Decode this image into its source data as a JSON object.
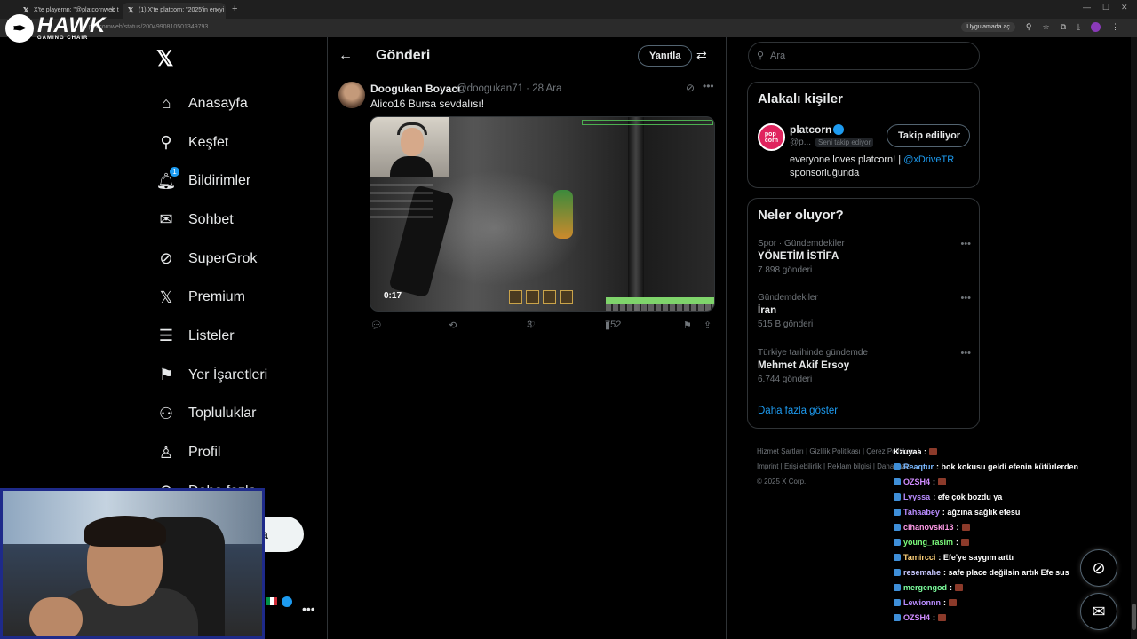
{
  "browser": {
    "tabs": [
      {
        "label": "X'te playernn: \"@platcornweb t"
      },
      {
        "label": "(1) X'te platcorn: \"2025'in en iyi"
      }
    ],
    "url": "platcornweb/status/2004990810501349793",
    "open_in_app": "Uygulamada aç"
  },
  "overlay_logo": {
    "brand": "HAWK",
    "sub": "GAMING CHAIR"
  },
  "nav": {
    "items": [
      {
        "label": "Anasayfa",
        "icon": "home-icon"
      },
      {
        "label": "Keşfet",
        "icon": "search-icon"
      },
      {
        "label": "Bildirimler",
        "icon": "bell-icon",
        "badge": "1"
      },
      {
        "label": "Sohbet",
        "icon": "mail-icon"
      },
      {
        "label": "SuperGrok",
        "icon": "grok-icon"
      },
      {
        "label": "Premium",
        "icon": "x-icon"
      },
      {
        "label": "Listeler",
        "icon": "list-icon"
      },
      {
        "label": "Yer İşaretleri",
        "icon": "bookmark-icon"
      },
      {
        "label": "Topluluklar",
        "icon": "communities-icon"
      },
      {
        "label": "Profil",
        "icon": "person-icon"
      },
      {
        "label": "Daha fazla",
        "icon": "more-circle-icon"
      }
    ],
    "post_button_visible": "a"
  },
  "header": {
    "title": "Gönderi",
    "reply_button": "Yanıtla"
  },
  "tweet": {
    "name": "Doogukan Boyacı",
    "handle": "@doogukan71 · 28 Ara",
    "text": "Alico16 Bursa sevdalısı!",
    "video_time": "0:17",
    "likes": "3",
    "views": "752"
  },
  "search": {
    "placeholder": "Ara"
  },
  "related": {
    "title": "Alakalı kişiler",
    "name": "platcorn",
    "handle": "@p...",
    "follows_you": "Seni takip ediyor",
    "follow_button": "Takip ediliyor",
    "bio_text": "everyone loves platcorn! | ",
    "bio_link": "@xDriveTR",
    "bio_end": "sponsorluğunda"
  },
  "trends": {
    "title": "Neler oluyor?",
    "items": [
      {
        "category": "Spor · Gündemdekiler",
        "name": "YÖNETİM İSTİFA",
        "count": "7.898 gönderi"
      },
      {
        "category": "Gündemdekiler",
        "name": "İran",
        "count": "515 B gönderi"
      },
      {
        "category": "Türkiye tarihinde gündemde",
        "name": "Mehmet Akif Ersoy",
        "count": "6.744 gönderi"
      }
    ],
    "show_more": "Daha fazla göster"
  },
  "footer": {
    "line1": "Hizmet Şartları  |  Gizlilik Politikası  |  Çerez Politikası  |",
    "line2": "Imprint  |  Erişilebilirlik  |  Reklam bilgisi  |  Daha fazla ...",
    "copyright": "© 2025 X Corp."
  },
  "chat": [
    {
      "user": "",
      "msg": "Kzuyaa :",
      "color": "#ffffff",
      "emote": true
    },
    {
      "user": "Reaqtur",
      "msg": ": bok kokusu geldi efenin küfürlerden",
      "color": "#7ab8ff",
      "emote": false
    },
    {
      "user": "OZSH4",
      "msg": ":",
      "color": "#d08cff",
      "emote": true
    },
    {
      "user": "Lyyssa",
      "msg": ": efe çok bozdu ya",
      "color": "#b98cff",
      "emote": false
    },
    {
      "user": "Tahaabey",
      "msg": ": ağzına sağlık efesu",
      "color": "#b98cff",
      "emote": false
    },
    {
      "user": "cihanovski13",
      "msg": ":",
      "color": "#ff9be8",
      "emote": true
    },
    {
      "user": "young_rasim",
      "msg": ":",
      "color": "#7dff7d",
      "emote": true
    },
    {
      "user": "Tamircci",
      "msg": ": Efe'ye saygım arttı",
      "color": "#ffd27a",
      "emote": false
    },
    {
      "user": "resemahe",
      "msg": ": safe place değilsin artık Efe sus",
      "color": "#c8c8ff",
      "emote": false
    },
    {
      "user": "mergengod",
      "msg": ":",
      "color": "#7dff9e",
      "emote": true
    },
    {
      "user": "Lewionnn",
      "msg": ":",
      "color": "#b98cff",
      "emote": true
    },
    {
      "user": "OZSH4",
      "msg": ":",
      "color": "#d08cff",
      "emote": true
    }
  ]
}
